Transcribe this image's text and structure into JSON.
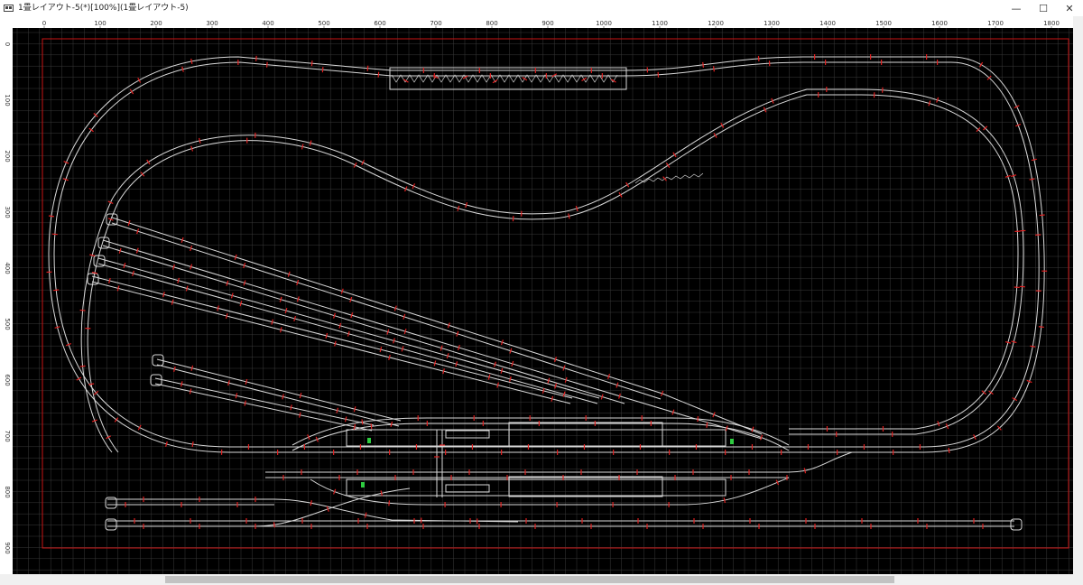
{
  "window": {
    "title": "1畳レイアウト-5(*)[100%](1畳レイアウト-5)",
    "minimize": "—",
    "maximize": "☐",
    "close": "✕"
  },
  "ruler": {
    "h_labels": [
      "0",
      "100",
      "200",
      "300",
      "400",
      "500",
      "600",
      "700",
      "800",
      "900",
      "1000",
      "1100",
      "1200",
      "1300",
      "1400",
      "1500",
      "1600",
      "1700",
      "1800"
    ],
    "v_labels": [
      "0",
      "100",
      "200",
      "300",
      "400",
      "500",
      "600",
      "700",
      "800",
      "900"
    ]
  },
  "colors": {
    "canvas": "#000000",
    "grid": "#3a3a3a",
    "track": "#d9d9d9",
    "joint": "#e02020",
    "boundary": "#c81414",
    "signal": "#2ecc40"
  },
  "icons": {
    "app": "app-icon",
    "minimize": "minimize-icon",
    "maximize": "maximize-icon",
    "close": "close-icon"
  }
}
